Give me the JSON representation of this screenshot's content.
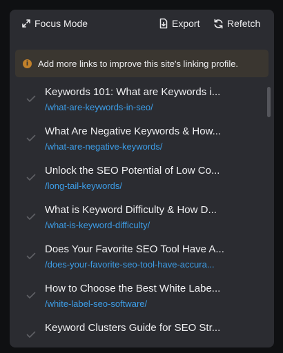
{
  "toolbar": {
    "focus_mode_label": "Focus Mode",
    "export_label": "Export",
    "refetch_label": "Refetch"
  },
  "notice": {
    "icon": "info-icon",
    "text": "Add more links to improve this site's linking profile."
  },
  "colors": {
    "panel_bg": "#2b2c31",
    "notice_bg": "#3a3630",
    "notice_icon": "#c2812a",
    "link": "#3d9ee8",
    "text": "#f0f0f2"
  },
  "links": [
    {
      "title": "Keywords 101: What are Keywords i...",
      "url": "/what-are-keywords-in-seo/"
    },
    {
      "title": "What Are Negative Keywords & How...",
      "url": "/what-are-negative-keywords/"
    },
    {
      "title": "Unlock the SEO Potential of Low Co...",
      "url": "/long-tail-keywords/"
    },
    {
      "title": "What is Keyword Difficulty & How D...",
      "url": "/what-is-keyword-difficulty/"
    },
    {
      "title": "Does Your Favorite SEO Tool Have A...",
      "url": "/does-your-favorite-seo-tool-have-accura..."
    },
    {
      "title": "How to Choose the Best White Labe...",
      "url": "/white-label-seo-software/"
    },
    {
      "title": "Keyword Clusters Guide for SEO Str...",
      "url": ""
    }
  ]
}
